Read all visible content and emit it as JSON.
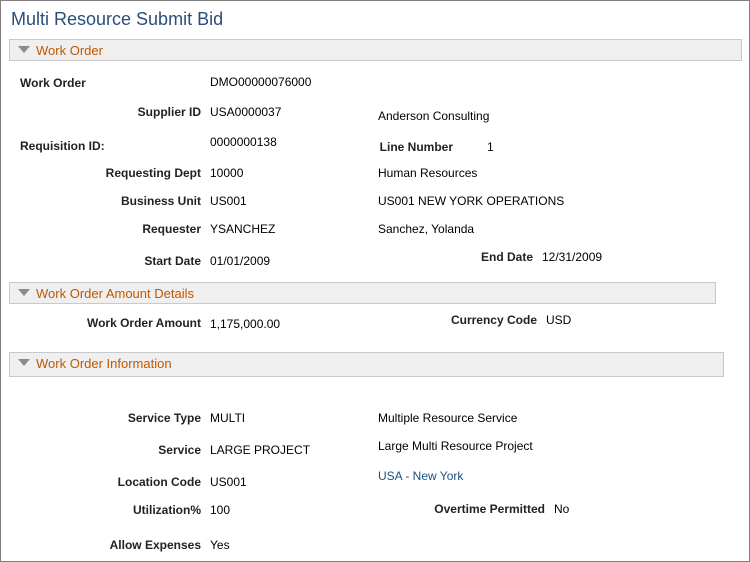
{
  "page_title": "Multi Resource Submit Bid",
  "sections": {
    "work_order": "Work Order",
    "amount_details": "Work Order Amount Details",
    "information": "Work Order Information"
  },
  "work_order": {
    "work_order_label": "Work Order",
    "work_order_value": "DMO00000076000",
    "supplier_id_label": "Supplier ID",
    "supplier_id_value": "USA0000037",
    "supplier_name": "Anderson Consulting",
    "requisition_id_label": "Requisition ID:",
    "requisition_id_value": "0000000138",
    "line_number_label": "Line Number",
    "line_number_value": "1",
    "requesting_dept_label": "Requesting Dept",
    "requesting_dept_value": "10000",
    "requesting_dept_desc": "Human Resources",
    "business_unit_label": "Business Unit",
    "business_unit_value": "US001",
    "business_unit_desc": "US001 NEW YORK OPERATIONS",
    "requester_label": "Requester",
    "requester_value": "YSANCHEZ",
    "requester_name": "Sanchez, Yolanda",
    "start_date_label": "Start Date",
    "start_date_value": "01/01/2009",
    "end_date_label": "End Date",
    "end_date_value": "12/31/2009"
  },
  "amount": {
    "amount_label": "Work Order Amount",
    "amount_value": "1,175,000.00",
    "currency_label": "Currency Code",
    "currency_value": "USD"
  },
  "information": {
    "service_type_label": "Service Type",
    "service_type_value": "MULTI",
    "service_type_desc": "Multiple Resource Service",
    "service_label": "Service",
    "service_value": "LARGE PROJECT",
    "service_desc": "Large Multi Resource Project",
    "location_label": "Location Code",
    "location_value": "US001",
    "location_desc": "USA - New York",
    "utilization_label": "Utilization%",
    "utilization_value": "100",
    "overtime_label": "Overtime Permitted",
    "overtime_value": "No",
    "expenses_label": "Allow Expenses",
    "expenses_value": "Yes"
  }
}
